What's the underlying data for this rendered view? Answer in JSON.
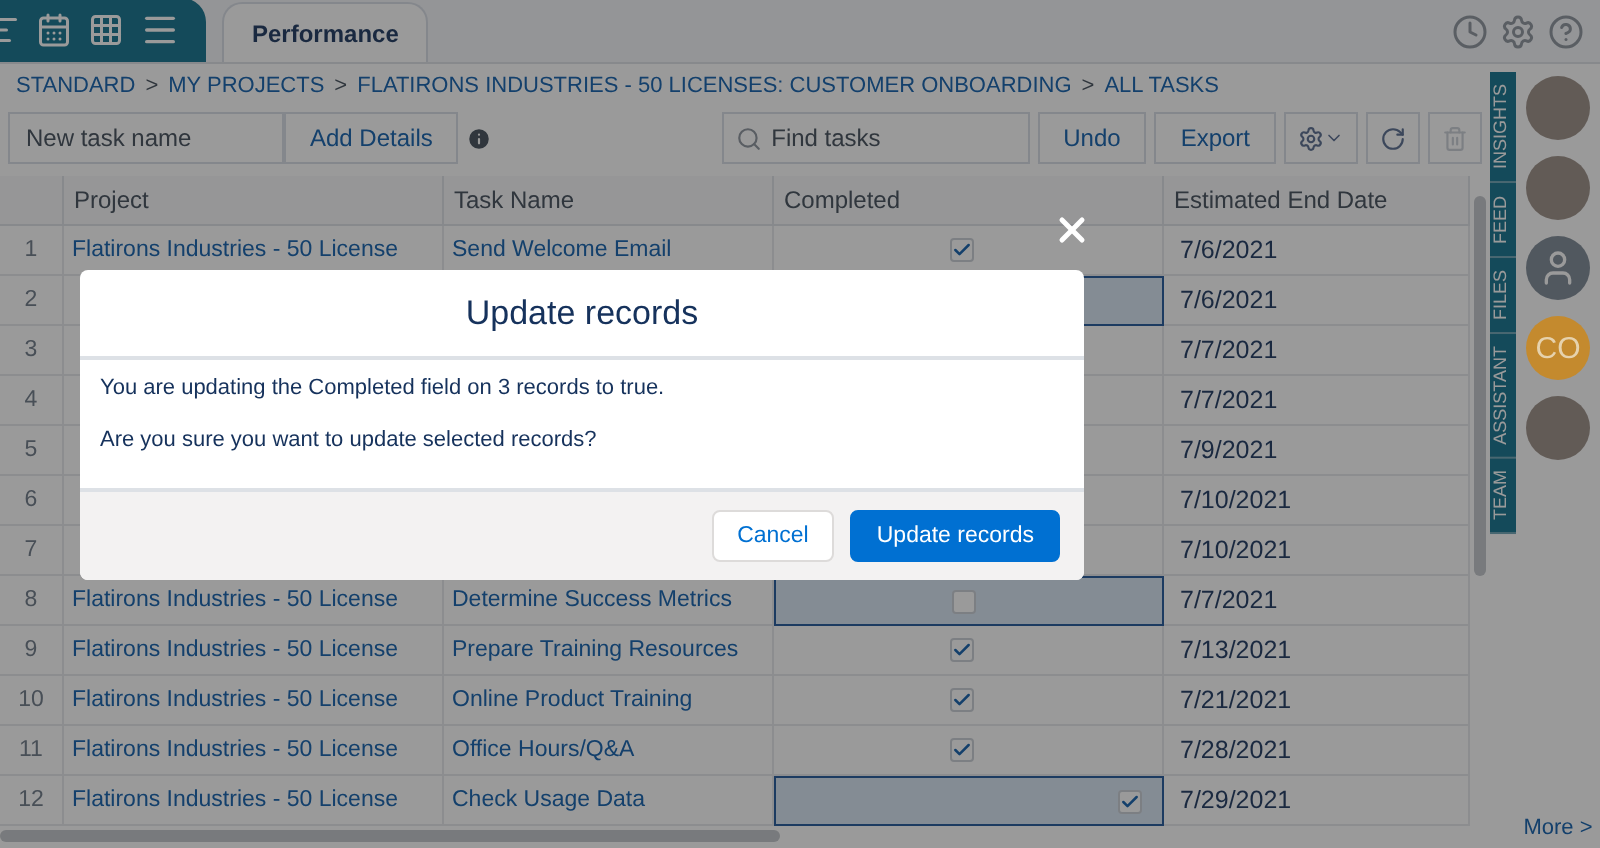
{
  "tabs": [
    {
      "label": "Performance",
      "selected": true
    }
  ],
  "breadcrumb": [
    "STANDARD",
    "MY PROJECTS",
    "FLATIRONS INDUSTRIES - 50 LICENSES: CUSTOMER ONBOARDING",
    "ALL TASKS"
  ],
  "breadcrumb_separator": ">",
  "toolbar": {
    "new_task": {
      "placeholder": "New task name"
    },
    "add_details": "Add Details",
    "search": {
      "placeholder": "Find tasks"
    },
    "undo": "Undo",
    "export": "Export"
  },
  "table": {
    "columns": [
      "Project",
      "Task Name",
      "Completed",
      "Estimated End Date"
    ],
    "rows": [
      {
        "number": "1",
        "project": "Flatirons Industries - 50 License",
        "task": "Send Welcome Email",
        "completed": true,
        "selected": false,
        "editing": false,
        "date": "7/6/2021"
      },
      {
        "number": "2",
        "selected": true,
        "date": "7/6/2021"
      },
      {
        "number": "3",
        "selected": false,
        "date": "7/7/2021"
      },
      {
        "number": "4",
        "selected": false,
        "date": "7/7/2021"
      },
      {
        "number": "5",
        "selected": false,
        "date": "7/9/2021"
      },
      {
        "number": "6",
        "selected": false,
        "date": "7/10/2021"
      },
      {
        "number": "7",
        "selected": false,
        "date": "7/10/2021"
      },
      {
        "number": "8",
        "project": "Flatirons Industries - 50 License",
        "task": "Determine Success Metrics",
        "completed": false,
        "selected": true,
        "editing": false,
        "date": "7/7/2021"
      },
      {
        "number": "9",
        "project": "Flatirons Industries - 50 License",
        "task": "Prepare Training Resources",
        "completed": true,
        "selected": false,
        "editing": false,
        "date": "7/13/2021"
      },
      {
        "number": "10",
        "project": "Flatirons Industries - 50 License",
        "task": "Online Product Training",
        "completed": true,
        "selected": false,
        "editing": false,
        "date": "7/21/2021"
      },
      {
        "number": "11",
        "project": "Flatirons Industries - 50 License",
        "task": "Office Hours/Q&A",
        "completed": true,
        "selected": false,
        "editing": false,
        "date": "7/28/2021"
      },
      {
        "number": "12",
        "project": "Flatirons Industries - 50 License",
        "task": "Check Usage Data",
        "completed": true,
        "selected": true,
        "editing": true,
        "date": "7/29/2021"
      }
    ]
  },
  "side_tabs": [
    "INSIGHTS",
    "FEED",
    "FILES",
    "ASSISTANT",
    "TEAM"
  ],
  "people": [
    {
      "kind": "photo"
    },
    {
      "kind": "photo"
    },
    {
      "kind": "silhouette"
    },
    {
      "kind": "initials",
      "initials": "CO",
      "color": "#c48a2e"
    },
    {
      "kind": "photo"
    }
  ],
  "more_link": "More >",
  "dialog": {
    "title": "Update records",
    "lines": [
      "You are updating the Completed field on 3 records to true.",
      "Are you sure you want to update selected records?"
    ],
    "cancel": "Cancel",
    "confirm": "Update records"
  }
}
